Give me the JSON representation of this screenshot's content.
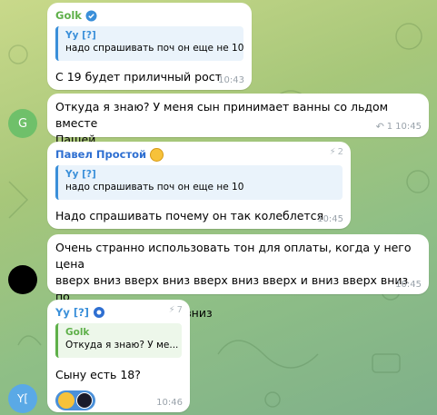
{
  "messages": [
    {
      "sender": "Golk",
      "sender_color": "#5fb04a",
      "quote_name": "Yy [?]",
      "quote_text": "надо спрашивать поч он еще не 10",
      "text": "С 19 будет приличный рост",
      "time": "10:43"
    },
    {
      "text_line1": "Откуда я знаю? У меня сын принимает ванны со льдом вместе",
      "text_line2": "Пашей",
      "reply_count": "1",
      "time": "10:45",
      "avatar_letter": "G",
      "avatar_color": "#6fc06a"
    },
    {
      "sender": "Павел Простой",
      "sender_color": "#2e6fd1",
      "forward_count": "2",
      "quote_name": "Yy [?]",
      "quote_text": "надо спрашивать поч он еще не 10",
      "text": "Надо спрашивать почему он так колеблется",
      "time": "10:45"
    },
    {
      "text_line1": "Очень странно использовать тон для оплаты, когда у него цена",
      "text_line2": "вверх вниз вверх вниз вверх вниз вверх и вниз вверх вниз по",
      "text_line3": "лестнице вниз вверх вниз",
      "time": "10:45",
      "avatar_color": "#000000"
    },
    {
      "sender": "Yy [?]",
      "sender_color": "#3a8fd9",
      "forward_count": "7",
      "quote_name": "Golk",
      "quote_text": "Откуда я знаю? У ме...",
      "text": "Сыну есть 18?",
      "time": "10:46",
      "avatar_letter": "Y[",
      "avatar_color": "#5aa9e6"
    }
  ]
}
